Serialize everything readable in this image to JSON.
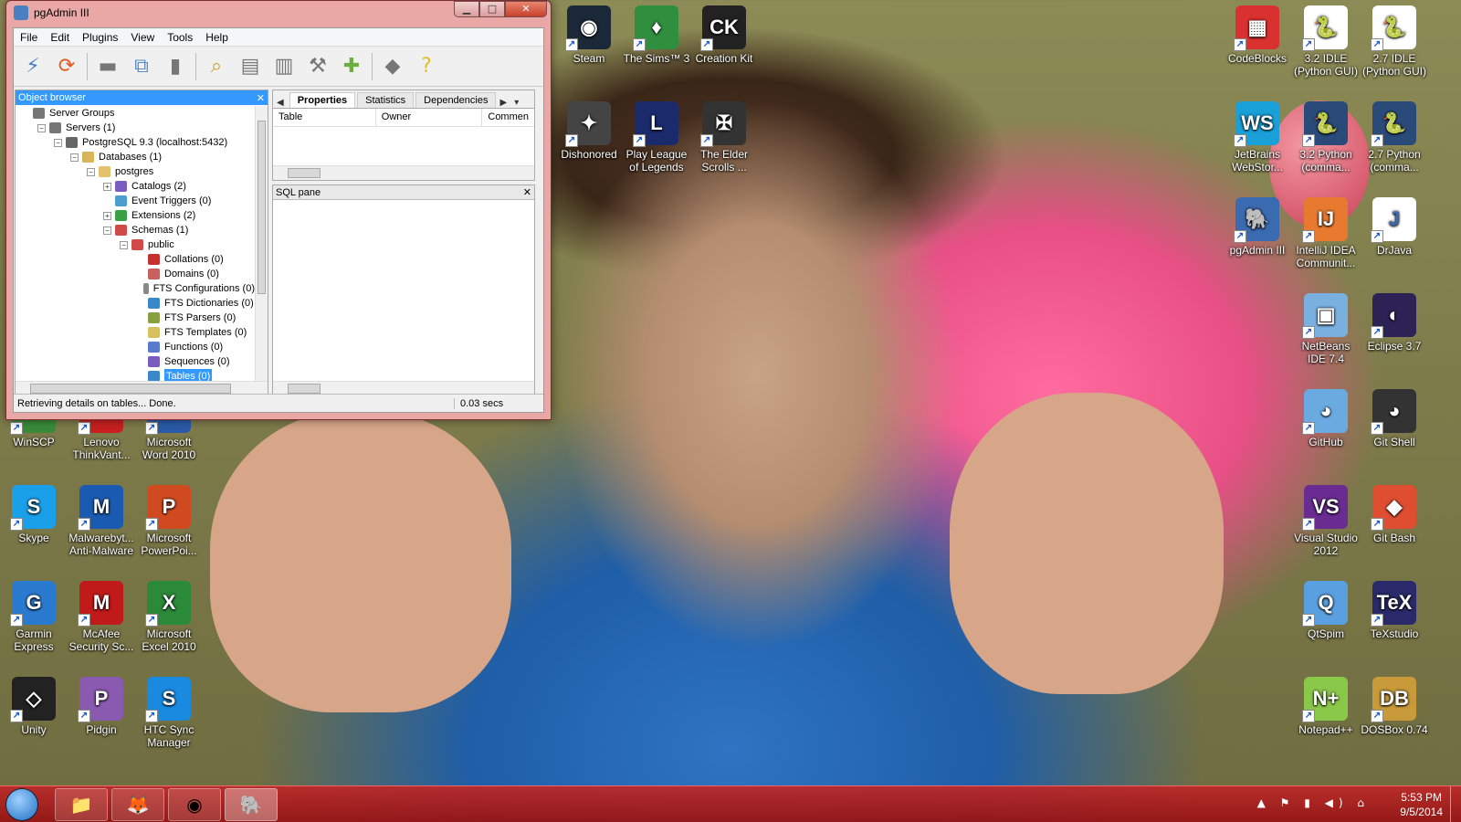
{
  "window": {
    "title": "pgAdmin III",
    "minimize": "▁",
    "maximize": "□",
    "close": "✕"
  },
  "menu": [
    "File",
    "Edit",
    "Plugins",
    "View",
    "Tools",
    "Help"
  ],
  "toolbar_icons": [
    "connect-icon",
    "refresh-icon",
    "properties-icon",
    "create-icon",
    "delete-icon",
    "sql-query-icon",
    "view-data-icon",
    "filtered-data-icon",
    "maintenance-icon",
    "plugins-icon",
    "hint-icon",
    "help-icon"
  ],
  "object_browser": {
    "title": "Object browser",
    "close": "✕",
    "tree": [
      {
        "label": "Server Groups",
        "depth": 0,
        "exp": "",
        "color": "#777777"
      },
      {
        "label": "Servers (1)",
        "depth": 1,
        "exp": "−",
        "color": "#777777"
      },
      {
        "label": "PostgreSQL 9.3 (localhost:5432)",
        "depth": 2,
        "exp": "−",
        "color": "#666666"
      },
      {
        "label": "Databases (1)",
        "depth": 3,
        "exp": "−",
        "color": "#d8b45a"
      },
      {
        "label": "postgres",
        "depth": 4,
        "exp": "−",
        "color": "#e2c26a"
      },
      {
        "label": "Catalogs (2)",
        "depth": 5,
        "exp": "+",
        "color": "#7a5cc0"
      },
      {
        "label": "Event Triggers (0)",
        "depth": 5,
        "exp": "",
        "color": "#4a9fd0"
      },
      {
        "label": "Extensions (2)",
        "depth": 5,
        "exp": "+",
        "color": "#3aa048"
      },
      {
        "label": "Schemas (1)",
        "depth": 5,
        "exp": "−",
        "color": "#d04a4a"
      },
      {
        "label": "public",
        "depth": 6,
        "exp": "−",
        "color": "#d04a4a"
      },
      {
        "label": "Collations (0)",
        "depth": 7,
        "exp": "",
        "color": "#c83030"
      },
      {
        "label": "Domains (0)",
        "depth": 7,
        "exp": "",
        "color": "#c86060"
      },
      {
        "label": "FTS Configurations (0)",
        "depth": 7,
        "exp": "",
        "color": "#888888"
      },
      {
        "label": "FTS Dictionaries (0)",
        "depth": 7,
        "exp": "",
        "color": "#3a88c8"
      },
      {
        "label": "FTS Parsers (0)",
        "depth": 7,
        "exp": "",
        "color": "#88a040"
      },
      {
        "label": "FTS Templates (0)",
        "depth": 7,
        "exp": "",
        "color": "#d8c060"
      },
      {
        "label": "Functions (0)",
        "depth": 7,
        "exp": "",
        "color": "#5a7ad0"
      },
      {
        "label": "Sequences (0)",
        "depth": 7,
        "exp": "",
        "color": "#7a5cc0"
      },
      {
        "label": "Tables (0)",
        "depth": 7,
        "exp": "",
        "color": "#3a88c8",
        "selected": true
      }
    ]
  },
  "properties": {
    "tabs": [
      "Properties",
      "Statistics",
      "Dependencies"
    ],
    "columns": [
      "Table",
      "Owner",
      "Commen"
    ]
  },
  "sql_pane": {
    "title": "SQL pane",
    "close": "✕"
  },
  "status": {
    "message": "Retrieving details on tables... Done.",
    "time": "0.03 secs"
  },
  "desktop_icons": [
    {
      "label": "Steam",
      "color": "#1b2838",
      "glyph": "◉"
    },
    {
      "label": "The Sims™ 3",
      "color": "#2f8f3f",
      "glyph": "♦"
    },
    {
      "label": "Creation Kit",
      "color": "#222222",
      "glyph": "CK"
    },
    {
      "label": "Dishonored",
      "color": "#444444",
      "glyph": "✦"
    },
    {
      "label": "Play League of Legends",
      "color": "#1a2a6a",
      "glyph": "L"
    },
    {
      "label": "The Elder Scrolls ...",
      "color": "#333333",
      "glyph": "✠"
    },
    {
      "label": "CodeBlocks",
      "color": "#d93030",
      "glyph": "▦"
    },
    {
      "label": "3.2 IDLE (Python GUI)",
      "color": "#ffffff",
      "glyph": "🐍"
    },
    {
      "label": "2.7 IDLE (Python GUI)",
      "color": "#ffffff",
      "glyph": "🐍"
    },
    {
      "label": "JetBrains WebStor...",
      "color": "#1aa0d8",
      "glyph": "WS"
    },
    {
      "label": "3.2 Python (comma...",
      "color": "#2a4a7a",
      "glyph": "🐍"
    },
    {
      "label": "2.7 Python (comma...",
      "color": "#2a4a7a",
      "glyph": "🐍"
    },
    {
      "label": "pgAdmin III",
      "color": "#3a6ab0",
      "glyph": "🐘"
    },
    {
      "label": "IntelliJ IDEA Communit...",
      "color": "#e87a30",
      "glyph": "IJ"
    },
    {
      "label": "DrJava",
      "color": "#ffffff",
      "glyph": "J"
    },
    {
      "label": "NetBeans IDE 7.4",
      "color": "#7ab0e0",
      "glyph": "▣"
    },
    {
      "label": "Eclipse 3.7",
      "color": "#2c2255",
      "glyph": "◐"
    },
    {
      "label": "GitHub",
      "color": "#6aaae0",
      "glyph": "◕"
    },
    {
      "label": "Git Shell",
      "color": "#333333",
      "glyph": "◕"
    },
    {
      "label": "Visual Studio 2012",
      "color": "#6a2c91",
      "glyph": "VS"
    },
    {
      "label": "Git Bash",
      "color": "#e04e32",
      "glyph": "◆"
    },
    {
      "label": "QtSpim",
      "color": "#5aa0e0",
      "glyph": "Q"
    },
    {
      "label": "TeXstudio",
      "color": "#2a2a6a",
      "glyph": "TeX"
    },
    {
      "label": "Notepad++",
      "color": "#8ac84a",
      "glyph": "N+"
    },
    {
      "label": "DOSBox 0.74",
      "color": "#c89a3a",
      "glyph": "DB"
    },
    {
      "label": "WinSCP",
      "color": "#3a8a3a",
      "glyph": "⇄"
    },
    {
      "label": "Lenovo ThinkVant...",
      "color": "#c82020",
      "glyph": "L"
    },
    {
      "label": "Microsoft Word 2010",
      "color": "#2a5aa8",
      "glyph": "W"
    },
    {
      "label": "Skype",
      "color": "#1aa0e8",
      "glyph": "S"
    },
    {
      "label": "Malwarebyt... Anti-Malware",
      "color": "#1a5ab0",
      "glyph": "M"
    },
    {
      "label": "Microsoft PowerPoi...",
      "color": "#d04a20",
      "glyph": "P"
    },
    {
      "label": "Garmin Express",
      "color": "#2a7ad0",
      "glyph": "G"
    },
    {
      "label": "McAfee Security Sc...",
      "color": "#c01a1a",
      "glyph": "M"
    },
    {
      "label": "Microsoft Excel 2010",
      "color": "#2a8a3a",
      "glyph": "X"
    },
    {
      "label": "Unity",
      "color": "#222222",
      "glyph": "◇"
    },
    {
      "label": "Pidgin",
      "color": "#8a5ab0",
      "glyph": "P"
    },
    {
      "label": "HTC Sync Manager",
      "color": "#1a8ae0",
      "glyph": "S"
    }
  ],
  "taskbar": {
    "buttons": [
      "explorer-icon",
      "firefox-icon",
      "chrome-icon",
      "pgadmin-icon"
    ],
    "tray": "▲ ⚑ ▮ ◀) ⌂",
    "time": "5:53 PM",
    "date": "9/5/2014"
  }
}
